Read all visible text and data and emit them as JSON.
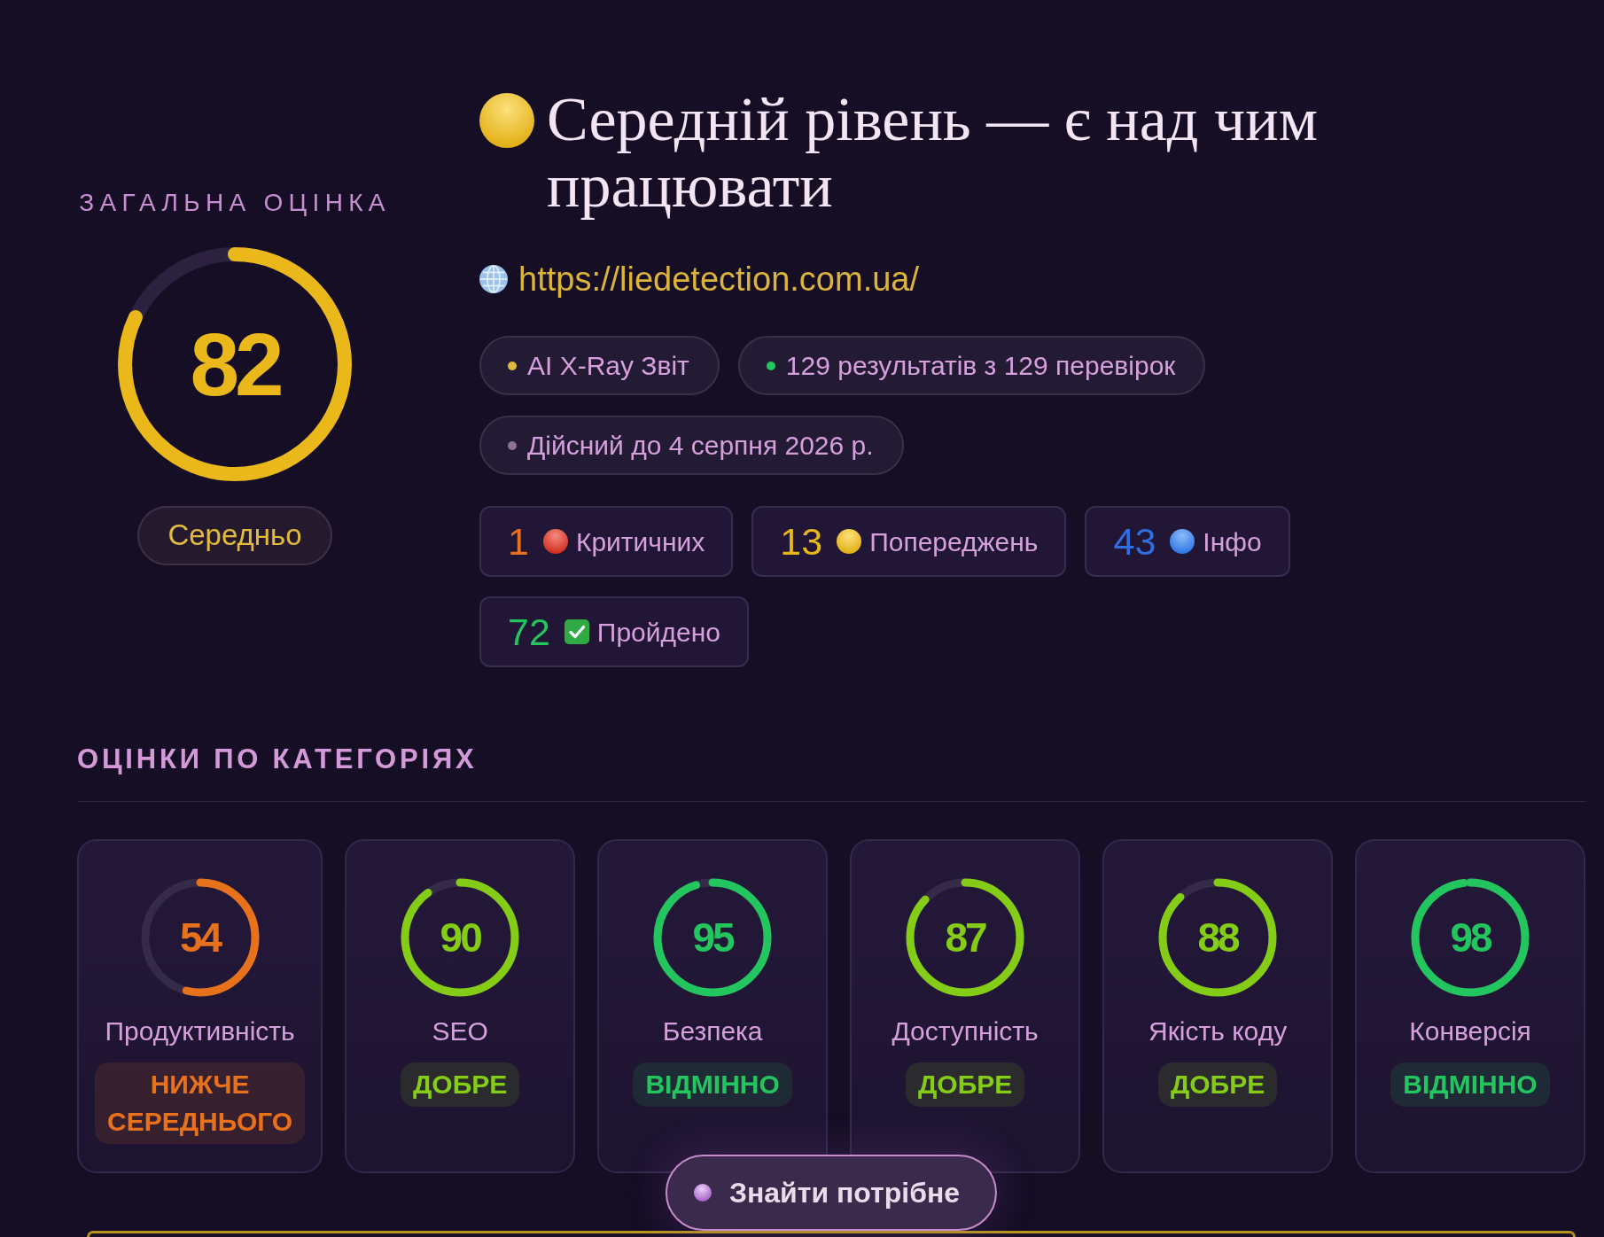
{
  "overall": {
    "label": "ЗАГАЛЬНА ОЦІНКА",
    "score": "82",
    "level": 0.82,
    "rating": "Середньо"
  },
  "title": "Середній рівень — є над чим працювати",
  "url": "https://liedetection.com.ua/",
  "tags": [
    {
      "text": "AI X-Ray Звіт",
      "color": "#e2b93b"
    },
    {
      "text": "129 результатів з 129 перевірок",
      "color": "#22c55e"
    },
    {
      "text": "Дійсний до 4 серпня 2026 р.",
      "color": "#8f7196"
    }
  ],
  "counts": [
    {
      "count": "1",
      "label": "Критичних",
      "kind": "critical"
    },
    {
      "count": "13",
      "label": "Попереджень",
      "kind": "warning"
    },
    {
      "count": "43",
      "label": "Інфо",
      "kind": "info"
    },
    {
      "count": "72",
      "label": "Пройдено",
      "kind": "passed"
    }
  ],
  "categories": {
    "title": "ОЦІНКИ ПО КАТЕГОРІЯХ",
    "items": [
      {
        "name": "Продуктивність",
        "score": "54",
        "level": 0.54,
        "rating": "НИЖЧЕ СЕРЕДНЬОГО",
        "color": "#e8711c"
      },
      {
        "name": "SEO",
        "score": "90",
        "level": 0.9,
        "rating": "ДОБРЕ",
        "color": "#84cc16"
      },
      {
        "name": "Безпека",
        "score": "95",
        "level": 0.95,
        "rating": "ВІДМІННО",
        "color": "#22c55e"
      },
      {
        "name": "Доступність",
        "score": "87",
        "level": 0.87,
        "rating": "ДОБРЕ",
        "color": "#84cc16"
      },
      {
        "name": "Якість коду",
        "score": "88",
        "level": 0.88,
        "rating": "ДОБРЕ",
        "color": "#84cc16"
      },
      {
        "name": "Конверсія",
        "score": "98",
        "level": 0.98,
        "rating": "ВІДМІННО",
        "color": "#22c55e"
      }
    ]
  },
  "find_button": {
    "label": "Знайти потрібне"
  }
}
